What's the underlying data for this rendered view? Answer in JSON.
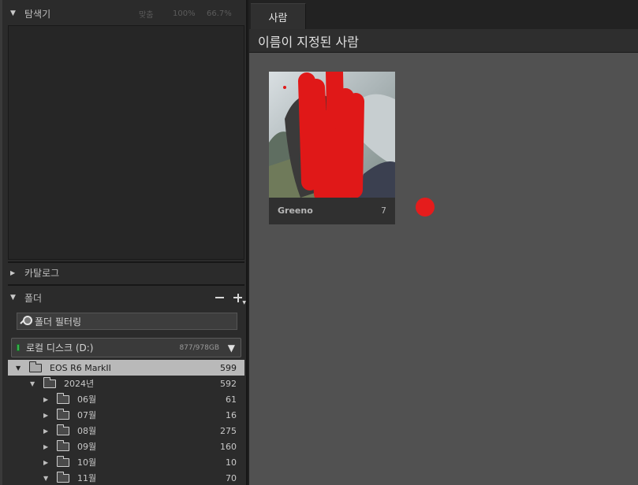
{
  "navigator": {
    "title": "탐색기",
    "zoom_options": [
      "맞춤",
      "100%",
      "66.7%"
    ]
  },
  "catalog": {
    "title": "카탈로그"
  },
  "folders": {
    "title": "폴더",
    "filter_placeholder": "폴더 필터링",
    "disk": {
      "name": "로컬 디스크 (D:)",
      "capacity": "877/978GB"
    },
    "tree": [
      {
        "label": "EOS R6 MarkII",
        "count": "599",
        "depth": 0,
        "expanded": true,
        "selected": true
      },
      {
        "label": "2024년",
        "count": "592",
        "depth": 1,
        "expanded": true
      },
      {
        "label": "06월",
        "count": "61",
        "depth": 2,
        "expanded": false
      },
      {
        "label": "07월",
        "count": "16",
        "depth": 2,
        "expanded": false
      },
      {
        "label": "08월",
        "count": "275",
        "depth": 2,
        "expanded": false
      },
      {
        "label": "09월",
        "count": "160",
        "depth": 2,
        "expanded": false
      },
      {
        "label": "10월",
        "count": "10",
        "depth": 2,
        "expanded": false
      },
      {
        "label": "11월",
        "count": "70",
        "depth": 2,
        "expanded": true
      }
    ]
  },
  "main": {
    "tab_label": "사람",
    "section_title": "이름이 지정된 사람",
    "person_card": {
      "name": "Greeno",
      "count": "7"
    }
  },
  "colors": {
    "scribble": "#e51c1c",
    "selected_row": "#b9b9b9",
    "disk_indicator": "#37b24d"
  }
}
